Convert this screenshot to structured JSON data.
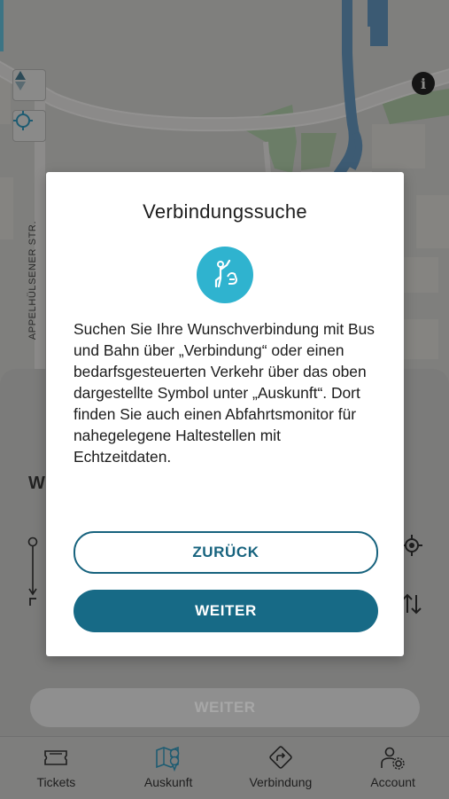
{
  "map": {
    "street_label": "APPELHÜLSENER STR.",
    "info_glyph": "i",
    "controls": [
      "compass-icon",
      "locate-icon"
    ]
  },
  "sheet": {
    "title_partial": "W",
    "search_button_label": "WEITER"
  },
  "modal": {
    "title": "Verbindungssuche",
    "icon": "on-demand-transport-icon",
    "body": "Suchen Sie Ihre Wunschverbindung mit Bus und Bahn über „Verbindung“ oder einen bedarfsgesteuerten Verkehr über das oben dargestellte Symbol unter „Auskunft“. Dort finden Sie auch einen Abfahrtsmonitor für nahegelegene Haltestellen mit Echtzeitdaten.",
    "back_label": "ZURÜCK",
    "next_label": "WEITER"
  },
  "tabbar": {
    "tabs": [
      {
        "label": "Tickets",
        "icon": "ticket-icon"
      },
      {
        "label": "Auskunft",
        "icon": "map-pin-icon"
      },
      {
        "label": "Verbindung",
        "icon": "route-direction-icon"
      },
      {
        "label": "Account",
        "icon": "user-settings-icon"
      }
    ]
  },
  "colors": {
    "accent": "#176a86",
    "icon_circle": "#2fb3cf",
    "overlay": "#7d7d7b"
  }
}
